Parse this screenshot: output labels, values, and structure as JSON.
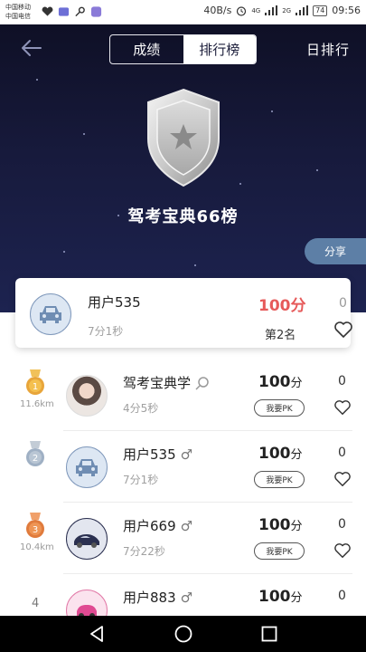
{
  "status_bar": {
    "carrier1": "中国移动",
    "carrier2": "中国电信",
    "speed": "40B/s",
    "net1": "4G",
    "net2": "2G",
    "battery": "74",
    "time": "09:56"
  },
  "header": {
    "tabs": [
      "成绩",
      "排行榜"
    ],
    "active_tab": "排行榜",
    "right_label": "日排行"
  },
  "hero": {
    "title": "驾考宝典66榜",
    "share_label": "分享"
  },
  "my_entry": {
    "name": "用户535",
    "time": "7分1秒",
    "score": "100分",
    "rank": "第2名",
    "likes": "0"
  },
  "entries": [
    {
      "rank": "1",
      "distance": "11.6km",
      "name": "驾考宝典学",
      "time": "4分5秒",
      "score_num": "100",
      "score_unit": "分",
      "pk_label": "我要PK",
      "likes": "0"
    },
    {
      "rank": "2",
      "distance": "",
      "name": "用户535",
      "time": "7分1秒",
      "score_num": "100",
      "score_unit": "分",
      "pk_label": "我要PK",
      "likes": "0"
    },
    {
      "rank": "3",
      "distance": "10.4km",
      "name": "用户669",
      "time": "7分22秒",
      "score_num": "100",
      "score_unit": "分",
      "pk_label": "我要PK",
      "likes": "0"
    },
    {
      "rank": "4",
      "distance": "",
      "name": "用户883",
      "time": "",
      "score_num": "100",
      "score_unit": "分",
      "pk_label": "",
      "likes": "0"
    }
  ],
  "colors": {
    "hero_bg": "#171a3c",
    "accent_red": "#e65a5a",
    "share_bg": "#5d7fa6",
    "gold": "#e8a53a",
    "silver": "#9fb0c4",
    "bronze": "#e07b3c"
  },
  "icons": {
    "back": "arrow-left-icon",
    "badge": "shield-star-badge-icon",
    "heart": "heart-outline-icon",
    "male": "male-symbol-icon",
    "search": "search-icon"
  }
}
